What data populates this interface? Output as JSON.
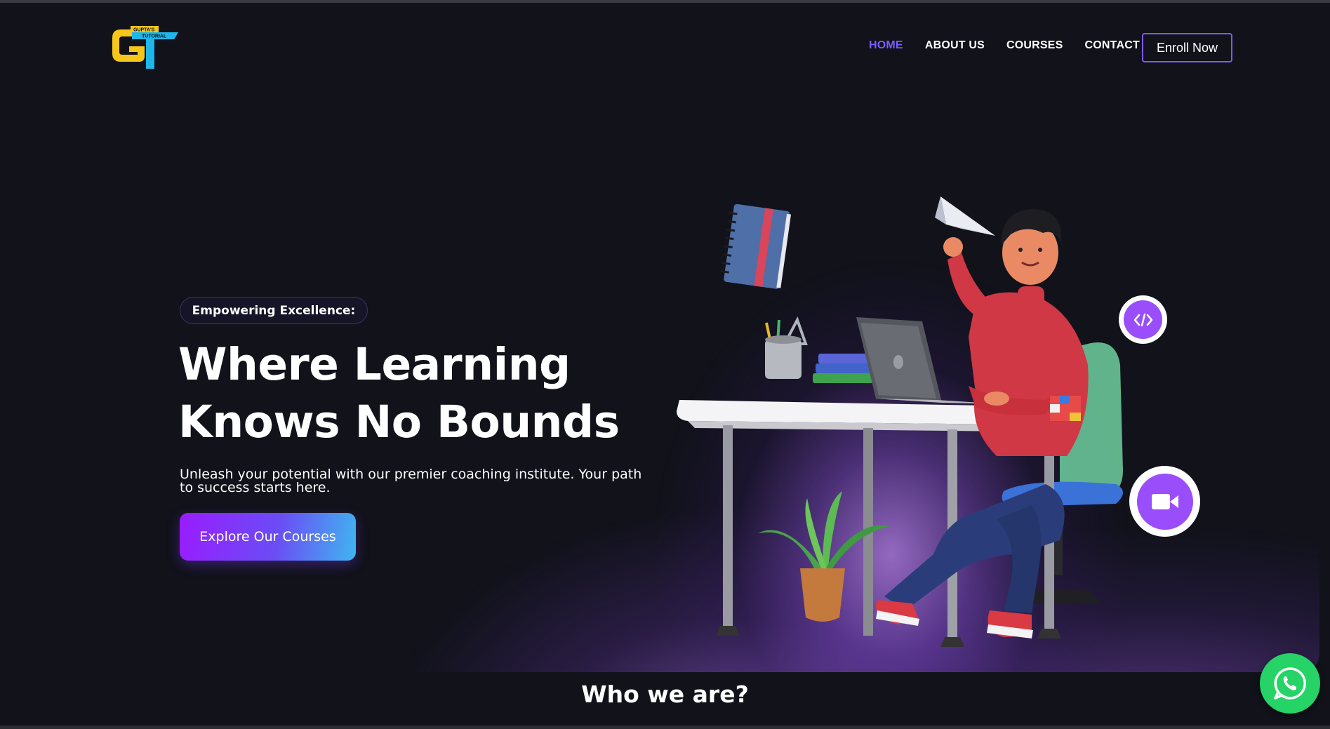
{
  "header": {
    "logo_text_top": "GUPTA'S",
    "logo_text_bottom": "TUTORIAL",
    "nav": [
      {
        "label": "HOME",
        "active": true
      },
      {
        "label": "ABOUT US",
        "active": false
      },
      {
        "label": "COURSES",
        "active": false
      },
      {
        "label": "CONTACT",
        "active": false
      }
    ],
    "enroll_label": "Enroll Now"
  },
  "hero": {
    "badge": "Empowering Excellence:",
    "headline_line1": "Where Learning",
    "headline_line2": "Knows No Bounds",
    "subtext": "Unleash your potential with our premier coaching institute. Your path to success starts here.",
    "cta_label": "Explore Our Courses"
  },
  "floating_icons": [
    "code-icon",
    "video-camera-icon"
  ],
  "next_section": {
    "title": "Who we are?"
  },
  "whatsapp": {
    "icon": "whatsapp-icon"
  },
  "colors": {
    "background": "#11121a",
    "accent": "#7a5cff",
    "cta_gradient_start": "#9a1cff",
    "cta_gradient_end": "#3fb6f0",
    "icon_purple": "#9a4dfa",
    "whatsapp_green": "#25d366"
  }
}
